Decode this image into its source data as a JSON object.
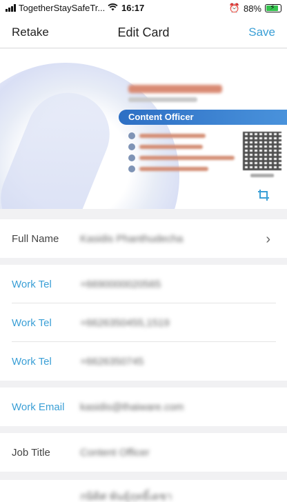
{
  "status_bar": {
    "carrier": "TogetherStaySafeTr...",
    "time": "16:17",
    "battery": "88%"
  },
  "nav": {
    "back_label": "Retake",
    "title": "Edit Card",
    "save_label": "Save"
  },
  "card": {
    "job_title_on_card": "Content Officer",
    "icons": {
      "crop": "crop-icon"
    }
  },
  "fields": [
    {
      "label": "Full Name",
      "value": "Kasidis Phanthudecha",
      "color": "gray",
      "chevron": true
    },
    {
      "label": "Work Tel",
      "value": "+6690000020565",
      "color": "blue"
    },
    {
      "label": "Work Tel",
      "value": "+6626350455,1519",
      "color": "blue"
    },
    {
      "label": "Work Tel",
      "value": "+6626350745",
      "color": "blue"
    },
    {
      "label": "Work Email",
      "value": "kasidis@thaiware.com",
      "color": "blue"
    },
    {
      "label": "Job Title",
      "value": "Content Officer",
      "color": "gray"
    },
    {
      "label": "",
      "value": "กษิดิศ พันธุ์ฤทธิ์เดชา",
      "color": "gray"
    }
  ],
  "colors": {
    "accent": "#3a9fd6",
    "card_band": "#2d6fc4",
    "battery": "#33c24d"
  }
}
